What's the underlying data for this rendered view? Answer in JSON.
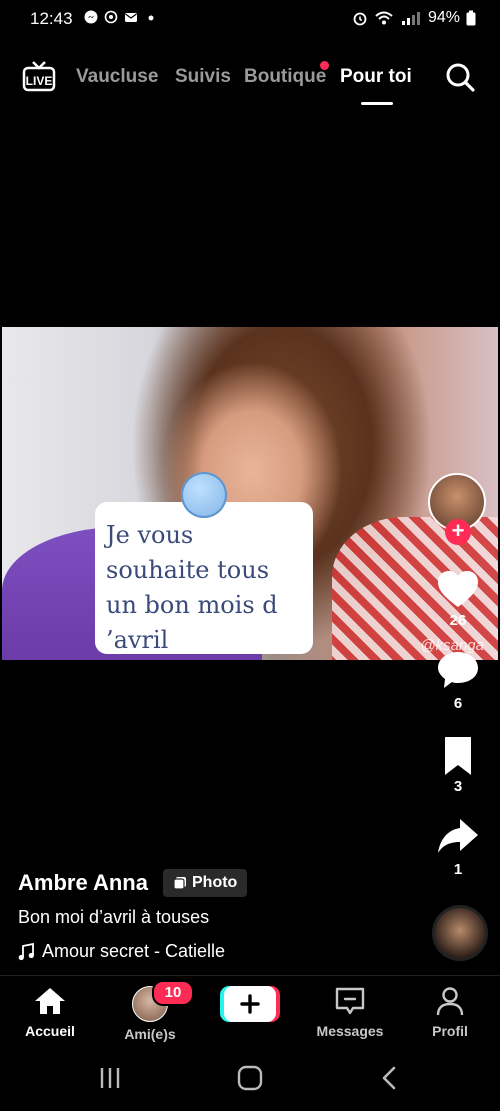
{
  "status": {
    "time": "12:43",
    "battery": "94%"
  },
  "top_nav": {
    "live": "LIVE",
    "tabs": [
      {
        "label": "Vaucluse"
      },
      {
        "label": "Suivis"
      },
      {
        "label": "Boutique"
      },
      {
        "label": "Pour toi"
      }
    ]
  },
  "post": {
    "note_text": "Je vous\nsouhaite tous\nun bon mois d\n’avril",
    "watermark": "@ksanga",
    "likes": "26",
    "comments": "6",
    "saves": "3",
    "shares": "1",
    "author": "Ambre Anna",
    "type_badge": "Photo",
    "caption": "Bon moi d’avril à touses",
    "music": "Amour secret - Catielle"
  },
  "bottom_nav": {
    "home": "Accueil",
    "friends": "Ami(e)s",
    "friends_badge": "10",
    "messages": "Messages",
    "profile": "Profil"
  },
  "colors": {
    "accent": "#fe2c55",
    "note_text": "#3a4a7a"
  }
}
